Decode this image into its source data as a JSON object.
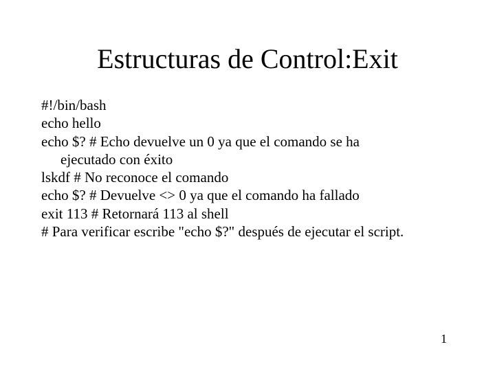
{
  "title": "Estructuras de Control:Exit",
  "lines": {
    "l0": "#!/bin/bash",
    "l1": "echo hello",
    "l2": "echo $?  # Echo devuelve un 0 ya que el comando se ha",
    "l2b": "ejecutado con éxito",
    "l3": "lskdf   # No reconoce el comando",
    "l4": "echo $? # Devuelve <> 0 ya que el comando ha fallado",
    "l5": "exit 113 # Retornará 113 al shell",
    "l6": "# Para verificar escribe \"echo $?\" después de ejecutar el script."
  },
  "page_number": "1"
}
